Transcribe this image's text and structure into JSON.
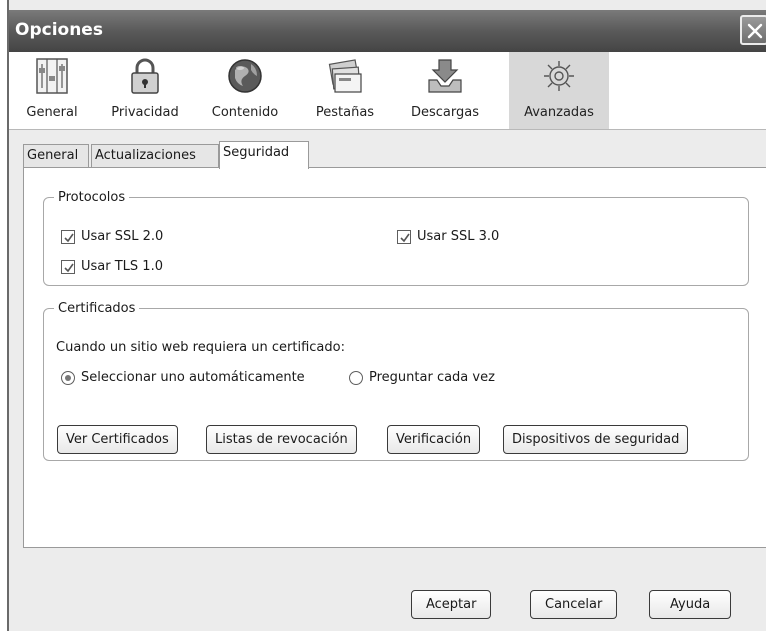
{
  "window": {
    "title": "Opciones"
  },
  "toolbar": {
    "items": [
      {
        "label": "General",
        "icon": "sliders-icon"
      },
      {
        "label": "Privacidad",
        "icon": "padlock-icon"
      },
      {
        "label": "Contenido",
        "icon": "globe-icon"
      },
      {
        "label": "Pestañas",
        "icon": "tabs-icon"
      },
      {
        "label": "Descargas",
        "icon": "download-tray-icon"
      },
      {
        "label": "Avanzadas",
        "icon": "gear-icon",
        "selected": true
      }
    ]
  },
  "tabs": [
    {
      "label": "General"
    },
    {
      "label": "Actualizaciones"
    },
    {
      "label": "Seguridad",
      "active": true
    }
  ],
  "protocolos": {
    "legend": "Protocolos",
    "ssl2": {
      "label": "Usar SSL 2.0",
      "checked": true
    },
    "ssl3": {
      "label": "Usar SSL 3.0",
      "checked": true
    },
    "tls1": {
      "label": "Usar TLS 1.0",
      "checked": true
    }
  },
  "certificados": {
    "legend": "Certificados",
    "prompt": "Cuando un sitio web requiera un certificado:",
    "radio_auto": {
      "label": "Seleccionar uno automáticamente",
      "selected": true
    },
    "radio_ask": {
      "label": "Preguntar cada vez",
      "selected": false
    },
    "buttons": {
      "ver": "Ver Certificados",
      "listas": "Listas de revocación",
      "verificacion": "Verificación",
      "dispositivos": "Dispositivos de seguridad"
    }
  },
  "footer": {
    "accept": "Aceptar",
    "cancel": "Cancelar",
    "help": "Ayuda"
  }
}
